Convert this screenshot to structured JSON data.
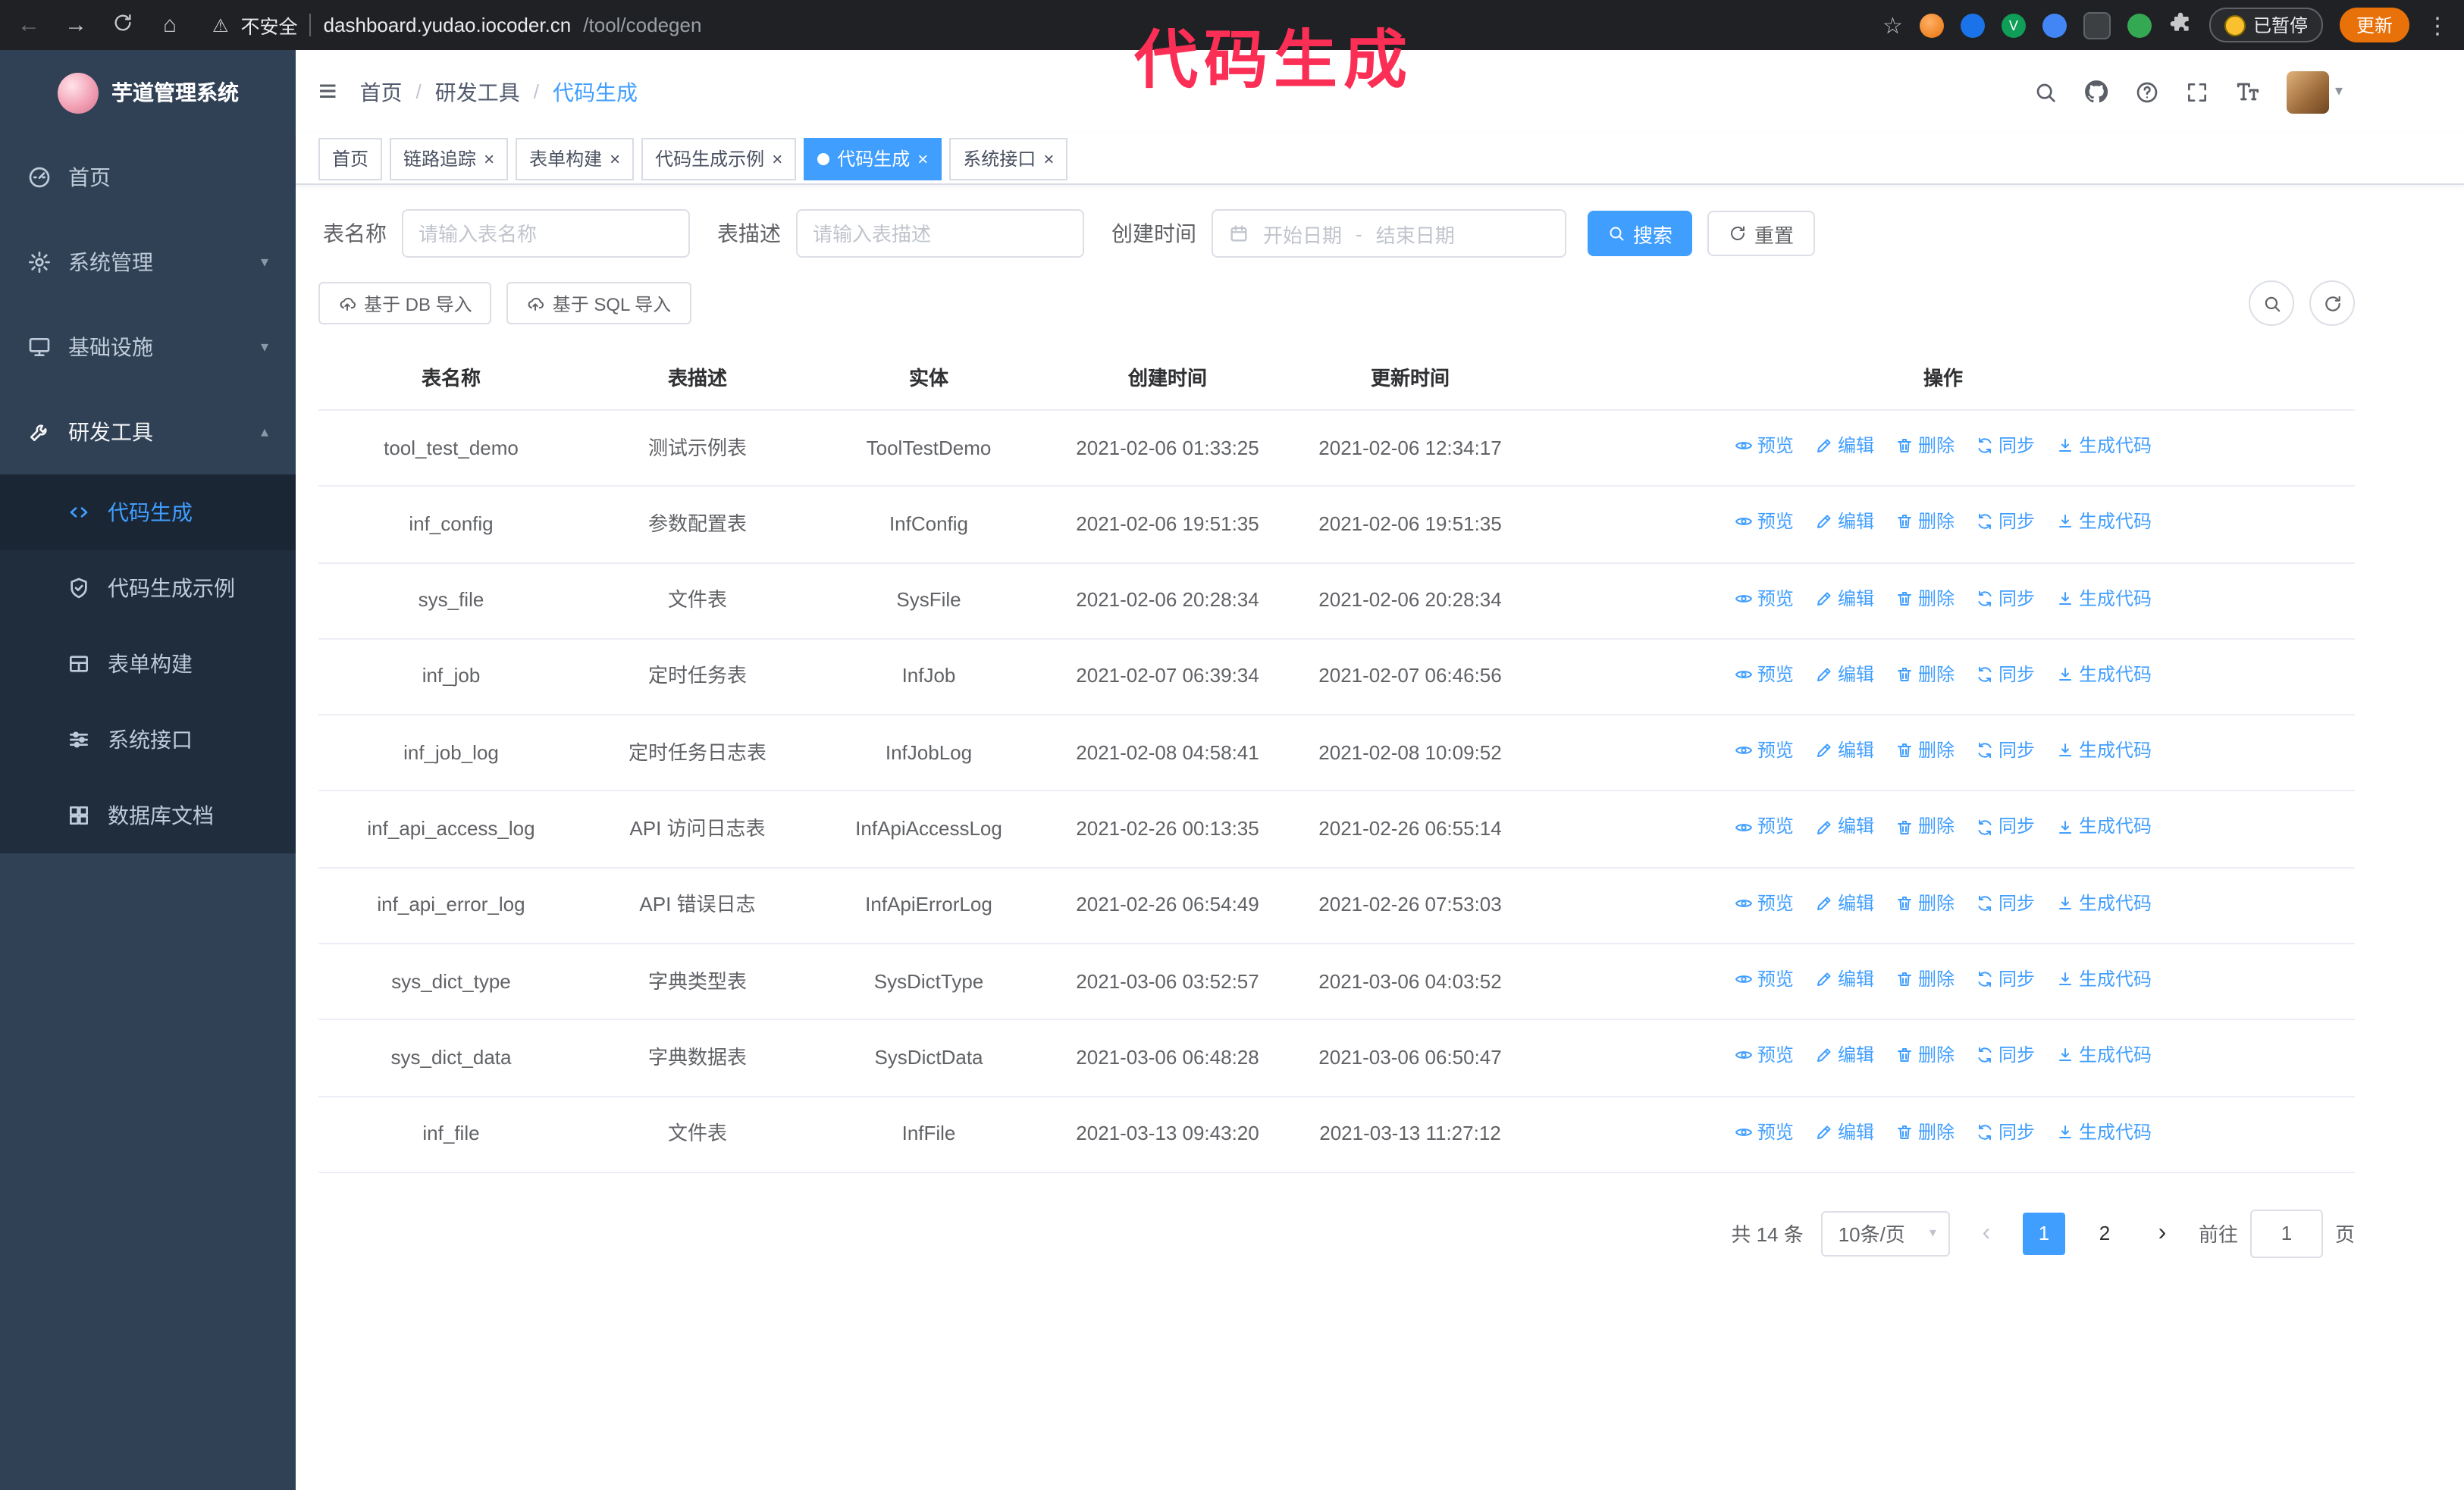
{
  "browser": {
    "security_label": "不安全",
    "url_host": "dashboard.yudao.iocoder.cn",
    "url_path": "/tool/codegen",
    "paused_badge": "已暂停",
    "update_button": "更新"
  },
  "annotation": {
    "text": "代码生成"
  },
  "colors": {
    "accent": "#409eff",
    "annotation": "#fb2e55",
    "sidebar_bg": "#304156",
    "submenu_bg": "#1f2d3d",
    "update_button_bg": "#e8710a"
  },
  "icons": {
    "back": "←",
    "forward": "→",
    "home": "⌂",
    "warning": "⚠",
    "star": "☆",
    "kebab": "⋮",
    "hamburger": "≡",
    "caret_down": "▾",
    "caret_up": "▴",
    "prev": "‹",
    "next": "›",
    "close": "×",
    "ext_v": "V"
  },
  "sidebar": {
    "logo_title": "芋道管理系统",
    "items": [
      "首页",
      "系统管理",
      "基础设施",
      "研发工具"
    ],
    "subitems": [
      "代码生成",
      "代码生成示例",
      "表单构建",
      "系统接口",
      "数据库文档"
    ]
  },
  "header": {
    "breadcrumb": [
      "首页",
      "研发工具",
      "代码生成"
    ]
  },
  "tabs": [
    "首页",
    "链路追踪",
    "表单构建",
    "代码生成示例",
    "代码生成",
    "系统接口"
  ],
  "filters": {
    "name_label": "表名称",
    "name_placeholder": "请输入表名称",
    "desc_label": "表描述",
    "desc_placeholder": "请输入表描述",
    "time_label": "创建时间",
    "start_placeholder": "开始日期",
    "range_separator": "-",
    "end_placeholder": "结束日期",
    "search": "搜索",
    "reset": "重置"
  },
  "toolbar": {
    "import_db": "基于 DB 导入",
    "import_sql": "基于 SQL 导入"
  },
  "table": {
    "columns": [
      "表名称",
      "表描述",
      "实体",
      "创建时间",
      "更新时间",
      "操作"
    ],
    "actions": [
      "预览",
      "编辑",
      "删除",
      "同步",
      "生成代码"
    ],
    "rows": [
      {
        "name": "tool_test_demo",
        "desc": "测试示例表",
        "entity": "ToolTestDemo",
        "created": "2021-02-06 01:33:25",
        "updated": "2021-02-06 12:34:17"
      },
      {
        "name": "inf_config",
        "desc": "参数配置表",
        "entity": "InfConfig",
        "created": "2021-02-06 19:51:35",
        "updated": "2021-02-06 19:51:35"
      },
      {
        "name": "sys_file",
        "desc": "文件表",
        "entity": "SysFile",
        "created": "2021-02-06 20:28:34",
        "updated": "2021-02-06 20:28:34"
      },
      {
        "name": "inf_job",
        "desc": "定时任务表",
        "entity": "InfJob",
        "created": "2021-02-07 06:39:34",
        "updated": "2021-02-07 06:46:56"
      },
      {
        "name": "inf_job_log",
        "desc": "定时任务日志表",
        "entity": "InfJobLog",
        "created": "2021-02-08 04:58:41",
        "updated": "2021-02-08 10:09:52"
      },
      {
        "name": "inf_api_access_log",
        "desc": "API 访问日志表",
        "entity": "InfApiAccessLog",
        "created": "2021-02-26 00:13:35",
        "updated": "2021-02-26 06:55:14"
      },
      {
        "name": "inf_api_error_log",
        "desc": "API 错误日志",
        "entity": "InfApiErrorLog",
        "created": "2021-02-26 06:54:49",
        "updated": "2021-02-26 07:53:03"
      },
      {
        "name": "sys_dict_type",
        "desc": "字典类型表",
        "entity": "SysDictType",
        "created": "2021-03-06 03:52:57",
        "updated": "2021-03-06 04:03:52"
      },
      {
        "name": "sys_dict_data",
        "desc": "字典数据表",
        "entity": "SysDictData",
        "created": "2021-03-06 06:48:28",
        "updated": "2021-03-06 06:50:47"
      },
      {
        "name": "inf_file",
        "desc": "文件表",
        "entity": "InfFile",
        "created": "2021-03-13 09:43:20",
        "updated": "2021-03-13 11:27:12"
      }
    ]
  },
  "pagination": {
    "total": "共 14 条",
    "page_size": "10条/页",
    "pages": [
      "1",
      "2"
    ],
    "active_page": "1",
    "goto_label": "前往",
    "goto_value": "1",
    "goto_suffix": "页"
  }
}
